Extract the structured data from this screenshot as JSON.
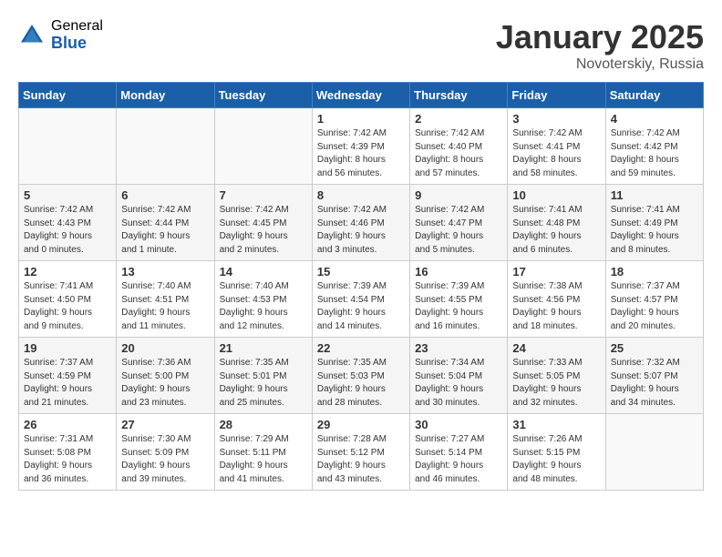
{
  "header": {
    "logo_general": "General",
    "logo_blue": "Blue",
    "title": "January 2025",
    "location": "Novoterskiy, Russia"
  },
  "weekdays": [
    "Sunday",
    "Monday",
    "Tuesday",
    "Wednesday",
    "Thursday",
    "Friday",
    "Saturday"
  ],
  "weeks": [
    [
      {
        "day": "",
        "info": ""
      },
      {
        "day": "",
        "info": ""
      },
      {
        "day": "",
        "info": ""
      },
      {
        "day": "1",
        "info": "Sunrise: 7:42 AM\nSunset: 4:39 PM\nDaylight: 8 hours\nand 56 minutes."
      },
      {
        "day": "2",
        "info": "Sunrise: 7:42 AM\nSunset: 4:40 PM\nDaylight: 8 hours\nand 57 minutes."
      },
      {
        "day": "3",
        "info": "Sunrise: 7:42 AM\nSunset: 4:41 PM\nDaylight: 8 hours\nand 58 minutes."
      },
      {
        "day": "4",
        "info": "Sunrise: 7:42 AM\nSunset: 4:42 PM\nDaylight: 8 hours\nand 59 minutes."
      }
    ],
    [
      {
        "day": "5",
        "info": "Sunrise: 7:42 AM\nSunset: 4:43 PM\nDaylight: 9 hours\nand 0 minutes."
      },
      {
        "day": "6",
        "info": "Sunrise: 7:42 AM\nSunset: 4:44 PM\nDaylight: 9 hours\nand 1 minute."
      },
      {
        "day": "7",
        "info": "Sunrise: 7:42 AM\nSunset: 4:45 PM\nDaylight: 9 hours\nand 2 minutes."
      },
      {
        "day": "8",
        "info": "Sunrise: 7:42 AM\nSunset: 4:46 PM\nDaylight: 9 hours\nand 3 minutes."
      },
      {
        "day": "9",
        "info": "Sunrise: 7:42 AM\nSunset: 4:47 PM\nDaylight: 9 hours\nand 5 minutes."
      },
      {
        "day": "10",
        "info": "Sunrise: 7:41 AM\nSunset: 4:48 PM\nDaylight: 9 hours\nand 6 minutes."
      },
      {
        "day": "11",
        "info": "Sunrise: 7:41 AM\nSunset: 4:49 PM\nDaylight: 9 hours\nand 8 minutes."
      }
    ],
    [
      {
        "day": "12",
        "info": "Sunrise: 7:41 AM\nSunset: 4:50 PM\nDaylight: 9 hours\nand 9 minutes."
      },
      {
        "day": "13",
        "info": "Sunrise: 7:40 AM\nSunset: 4:51 PM\nDaylight: 9 hours\nand 11 minutes."
      },
      {
        "day": "14",
        "info": "Sunrise: 7:40 AM\nSunset: 4:53 PM\nDaylight: 9 hours\nand 12 minutes."
      },
      {
        "day": "15",
        "info": "Sunrise: 7:39 AM\nSunset: 4:54 PM\nDaylight: 9 hours\nand 14 minutes."
      },
      {
        "day": "16",
        "info": "Sunrise: 7:39 AM\nSunset: 4:55 PM\nDaylight: 9 hours\nand 16 minutes."
      },
      {
        "day": "17",
        "info": "Sunrise: 7:38 AM\nSunset: 4:56 PM\nDaylight: 9 hours\nand 18 minutes."
      },
      {
        "day": "18",
        "info": "Sunrise: 7:37 AM\nSunset: 4:57 PM\nDaylight: 9 hours\nand 20 minutes."
      }
    ],
    [
      {
        "day": "19",
        "info": "Sunrise: 7:37 AM\nSunset: 4:59 PM\nDaylight: 9 hours\nand 21 minutes."
      },
      {
        "day": "20",
        "info": "Sunrise: 7:36 AM\nSunset: 5:00 PM\nDaylight: 9 hours\nand 23 minutes."
      },
      {
        "day": "21",
        "info": "Sunrise: 7:35 AM\nSunset: 5:01 PM\nDaylight: 9 hours\nand 25 minutes."
      },
      {
        "day": "22",
        "info": "Sunrise: 7:35 AM\nSunset: 5:03 PM\nDaylight: 9 hours\nand 28 minutes."
      },
      {
        "day": "23",
        "info": "Sunrise: 7:34 AM\nSunset: 5:04 PM\nDaylight: 9 hours\nand 30 minutes."
      },
      {
        "day": "24",
        "info": "Sunrise: 7:33 AM\nSunset: 5:05 PM\nDaylight: 9 hours\nand 32 minutes."
      },
      {
        "day": "25",
        "info": "Sunrise: 7:32 AM\nSunset: 5:07 PM\nDaylight: 9 hours\nand 34 minutes."
      }
    ],
    [
      {
        "day": "26",
        "info": "Sunrise: 7:31 AM\nSunset: 5:08 PM\nDaylight: 9 hours\nand 36 minutes."
      },
      {
        "day": "27",
        "info": "Sunrise: 7:30 AM\nSunset: 5:09 PM\nDaylight: 9 hours\nand 39 minutes."
      },
      {
        "day": "28",
        "info": "Sunrise: 7:29 AM\nSunset: 5:11 PM\nDaylight: 9 hours\nand 41 minutes."
      },
      {
        "day": "29",
        "info": "Sunrise: 7:28 AM\nSunset: 5:12 PM\nDaylight: 9 hours\nand 43 minutes."
      },
      {
        "day": "30",
        "info": "Sunrise: 7:27 AM\nSunset: 5:14 PM\nDaylight: 9 hours\nand 46 minutes."
      },
      {
        "day": "31",
        "info": "Sunrise: 7:26 AM\nSunset: 5:15 PM\nDaylight: 9 hours\nand 48 minutes."
      },
      {
        "day": "",
        "info": ""
      }
    ]
  ]
}
